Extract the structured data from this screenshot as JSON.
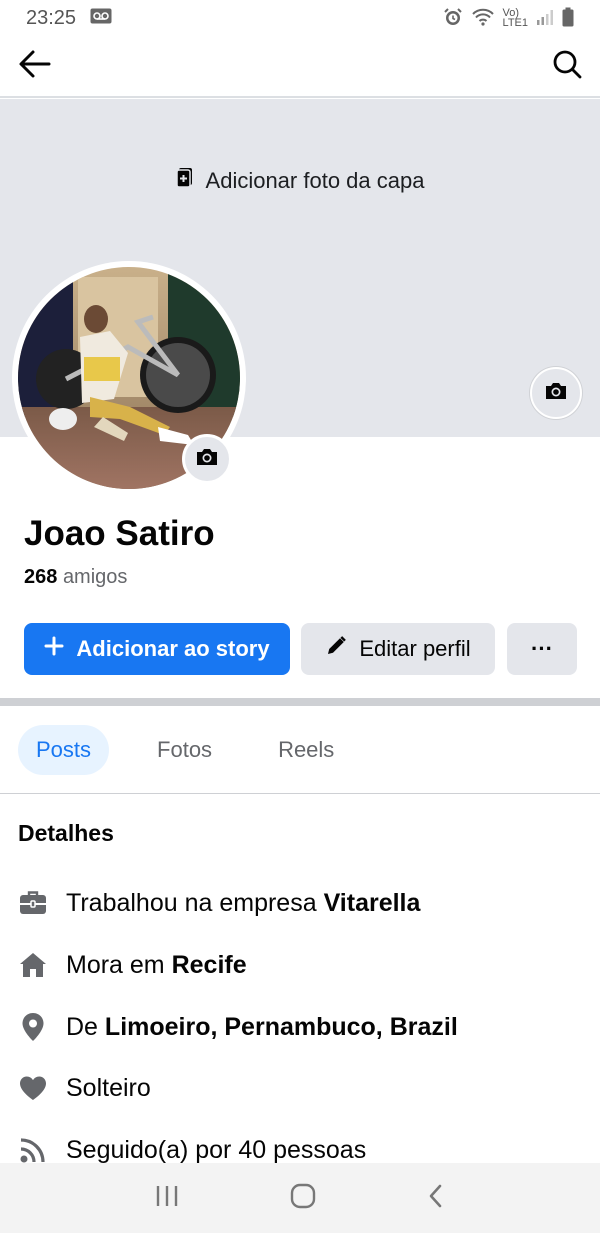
{
  "status_bar": {
    "time": "23:25",
    "network_label_top": "Vo)",
    "network_label_bottom": "LTE1"
  },
  "topnav": {
    "back_icon": "arrow-left-icon",
    "search_icon": "search-icon"
  },
  "cover": {
    "add_cover_label": "Adicionar foto da capa"
  },
  "profile": {
    "name": "Joao Satiro",
    "friends_count": "268",
    "friends_label": "amigos"
  },
  "actions": {
    "add_story_label": "Adicionar ao story",
    "edit_profile_label": "Editar perfil",
    "more_label": "···"
  },
  "tabs": [
    {
      "label": "Posts",
      "active": true
    },
    {
      "label": "Fotos",
      "active": false
    },
    {
      "label": "Reels",
      "active": false
    }
  ],
  "details": {
    "title": "Detalhes",
    "work_prefix": "Trabalhou na empresa",
    "work_company": "Vitarella",
    "lives_prefix": "Mora em",
    "lives_city": "Recife",
    "from_prefix": "De",
    "from_place": "Limoeiro, Pernambuco, Brazil",
    "relationship": "Solteiro",
    "followers": "Seguido(a) por 40 pessoas"
  },
  "colors": {
    "accent": "#1877f2",
    "cover_bg": "#e4e6eb",
    "secondary_text": "#65676b"
  }
}
